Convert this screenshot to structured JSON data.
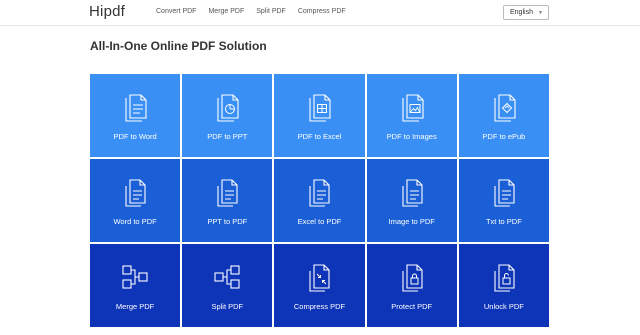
{
  "header": {
    "brand": "Hipdf",
    "nav": [
      "Convert PDF",
      "Merge PDF",
      "Split PDF",
      "Compress PDF"
    ],
    "language": "English"
  },
  "main": {
    "title": "All-In-One Online PDF Solution"
  },
  "tools": [
    {
      "label": "PDF to Word",
      "icon": "doc-lines-icon"
    },
    {
      "label": "PDF to PPT",
      "icon": "doc-pie-icon"
    },
    {
      "label": "PDF to Excel",
      "icon": "doc-table-icon"
    },
    {
      "label": "PDF to Images",
      "icon": "doc-image-icon"
    },
    {
      "label": "PDF to ePub",
      "icon": "doc-epub-icon"
    },
    {
      "label": "Word to PDF",
      "icon": "file-lines-icon"
    },
    {
      "label": "PPT to PDF",
      "icon": "file-lines-icon"
    },
    {
      "label": "Excel to PDF",
      "icon": "file-lines-icon"
    },
    {
      "label": "Image to PDF",
      "icon": "file-lines-icon"
    },
    {
      "label": "Txt to PDF",
      "icon": "file-lines-icon"
    },
    {
      "label": "Merge PDF",
      "icon": "merge-icon"
    },
    {
      "label": "Split PDF",
      "icon": "split-icon"
    },
    {
      "label": "Compress PDF",
      "icon": "compress-icon"
    },
    {
      "label": "Protect PDF",
      "icon": "lock-icon"
    },
    {
      "label": "Unlock PDF",
      "icon": "unlock-icon"
    }
  ],
  "colors": {
    "row1": "#3a8ff5",
    "row2": "#1a5fd6",
    "row3": "#0e34b8"
  }
}
